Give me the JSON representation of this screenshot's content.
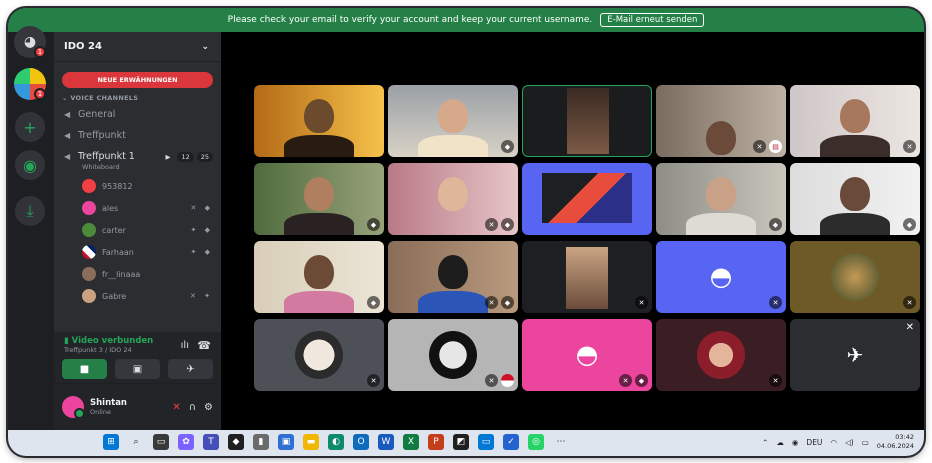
{
  "banner": {
    "message": "Please check your email to verify your account and keep your current username.",
    "button_label": "E-Mail erneut senden"
  },
  "rail": {
    "badges": [
      "1",
      "1"
    ],
    "icons": [
      "discord-home-icon",
      "server-ido24-icon",
      "add-server-icon",
      "discover-icon",
      "download-icon"
    ]
  },
  "sidebar": {
    "server_name": "IDO 24",
    "new_events_label": "NEUE ERWÄHNUNGEN",
    "category_label": "VOICE CHANNELS",
    "channels": [
      {
        "name": "General"
      },
      {
        "name": "Treffpunkt"
      },
      {
        "name": "Treffpunkt 1",
        "subtitle": "Whiteboard",
        "count_a": "12",
        "count_b": "25"
      }
    ],
    "users": [
      {
        "name": "953812"
      },
      {
        "name": "ales"
      },
      {
        "name": "carter"
      },
      {
        "name": "Farhaan"
      },
      {
        "name": "fr__linaaa"
      },
      {
        "name": "Gabre"
      }
    ]
  },
  "voice_status": {
    "status": "Video verbunden",
    "channel": "Treffpunkt 3 / IDO 24"
  },
  "user_panel": {
    "username": "Shintan",
    "status": "Online"
  },
  "taskbar": {
    "language": "DEU",
    "time": "03:42",
    "date": "04.06.2024"
  },
  "colors": {
    "banner": "#248046",
    "accent": "#5865f2",
    "danger": "#da373c",
    "online": "#23a55a"
  }
}
